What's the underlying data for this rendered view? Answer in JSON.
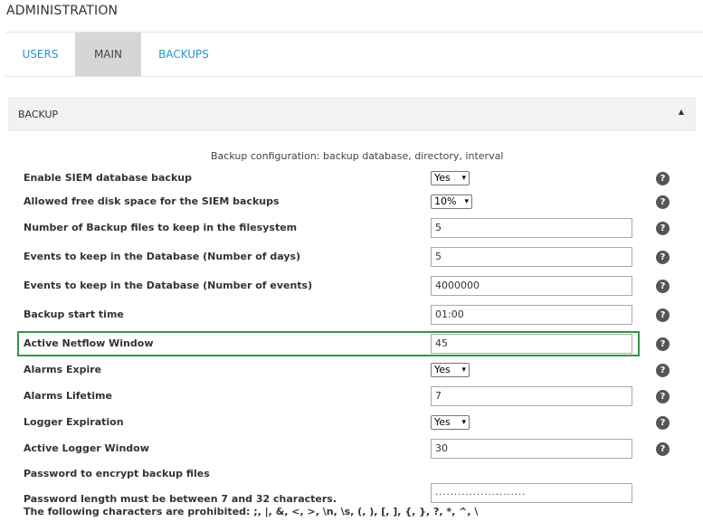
{
  "page": {
    "title": "ADMINISTRATION"
  },
  "tabs": [
    {
      "label": "USERS",
      "active": false
    },
    {
      "label": "MAIN",
      "active": true
    },
    {
      "label": "BACKUPS",
      "active": false
    }
  ],
  "section": {
    "title": "BACKUP",
    "collapse_icon": "triangle-up-icon",
    "description": "Backup configuration: backup database, directory, interval"
  },
  "rows": [
    {
      "label": "Enable SIEM database backup",
      "type": "select",
      "value": "Yes"
    },
    {
      "label": "Allowed free disk space for the SIEM backups",
      "type": "select",
      "value": "10%"
    },
    {
      "label": "Number of Backup files to keep in the filesystem",
      "type": "input",
      "value": "5"
    },
    {
      "label": "Events to keep in the Database (Number of days)",
      "type": "input",
      "value": "5"
    },
    {
      "label": "Events to keep in the Database (Number of events)",
      "type": "input",
      "value": "4000000"
    },
    {
      "label": "Backup start time",
      "type": "input",
      "value": "01:00"
    },
    {
      "label": "Active Netflow Window",
      "type": "input",
      "value": "45"
    },
    {
      "label": "Alarms Expire",
      "type": "select",
      "value": "Yes"
    },
    {
      "label": "Alarms Lifetime",
      "type": "input",
      "value": "7"
    },
    {
      "label": "Logger Expiration",
      "type": "select",
      "value": "Yes"
    },
    {
      "label": "Active Logger Window",
      "type": "input",
      "value": "30"
    }
  ],
  "password": {
    "label": "Password to encrypt backup files",
    "note_line1": "Password length must be between 7 and 32 characters.",
    "note_line2": "The following characters are prohibited: ;, |, &, <, >, \\n, \\s, (, ), [, ], {, }, ?, *, ^, \\",
    "masked_value": "........................"
  },
  "help_glyph": "?",
  "caret_glyph": "▾",
  "colors": {
    "accent": "#2b95c7",
    "highlight": "#2e9a3f",
    "active_tab": "#d6d6d6"
  }
}
